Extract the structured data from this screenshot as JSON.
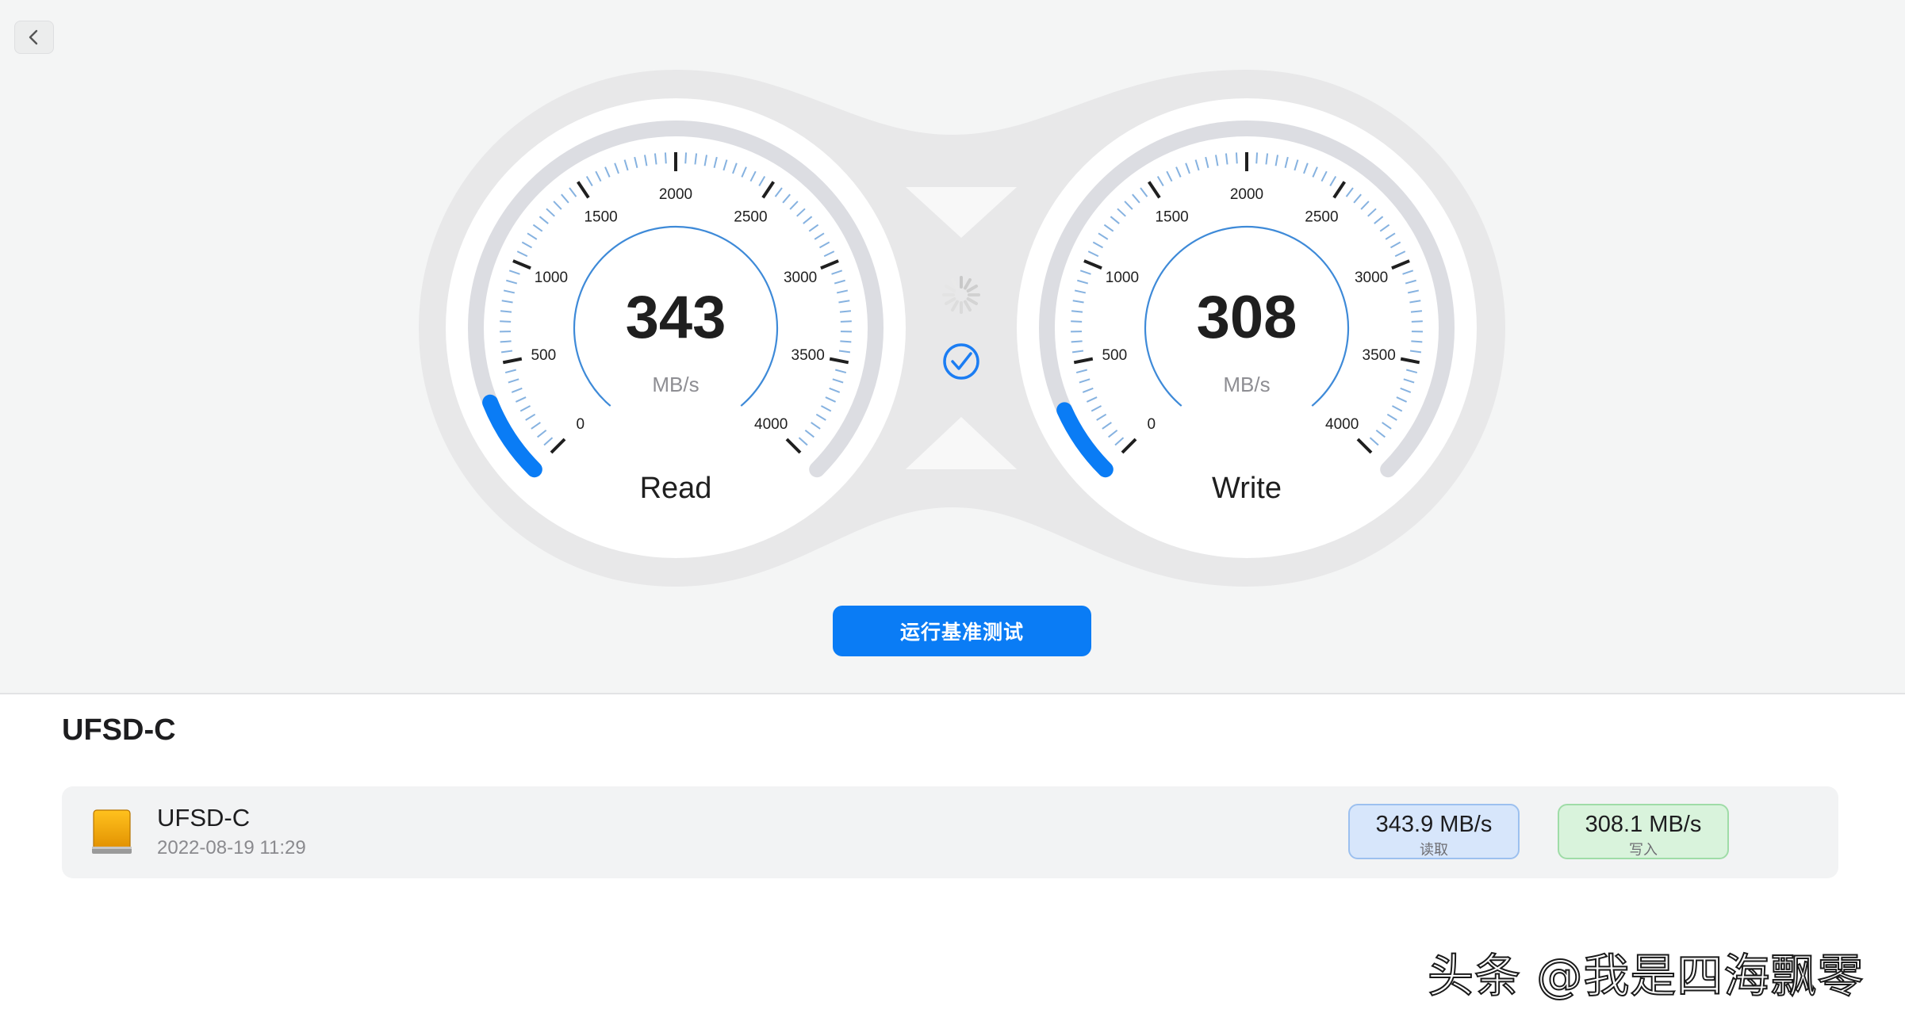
{
  "toolbar": {
    "back_icon": "chevron-left-icon"
  },
  "colors": {
    "accent": "#0a7cf5",
    "read_pill_bg": "#d7e6fb",
    "write_pill_bg": "#d9f3dc"
  },
  "gauges": {
    "tick_labels": [
      "0",
      "500",
      "1000",
      "1500",
      "2000",
      "2500",
      "3000",
      "3500",
      "4000"
    ],
    "max": 4000,
    "read": {
      "value": "343",
      "value_num": 343,
      "unit": "MB/s",
      "label": "Read"
    },
    "write": {
      "value": "308",
      "value_num": 308,
      "unit": "MB/s",
      "label": "Write"
    }
  },
  "status": {
    "spinner_icon": "spinner-icon",
    "done_icon": "checkmark-circle-icon"
  },
  "run_button": {
    "label": "运行基准测试"
  },
  "device": {
    "heading": "UFSD-C"
  },
  "results": [
    {
      "name": "UFSD-C",
      "date": "2022-08-19 11:29",
      "icon": "external-drive-icon",
      "read_value": "343.9 MB/s",
      "read_label": "读取",
      "write_value": "308.1 MB/s",
      "write_label": "写入"
    }
  ],
  "watermark": "头条 @我是四海飘零"
}
